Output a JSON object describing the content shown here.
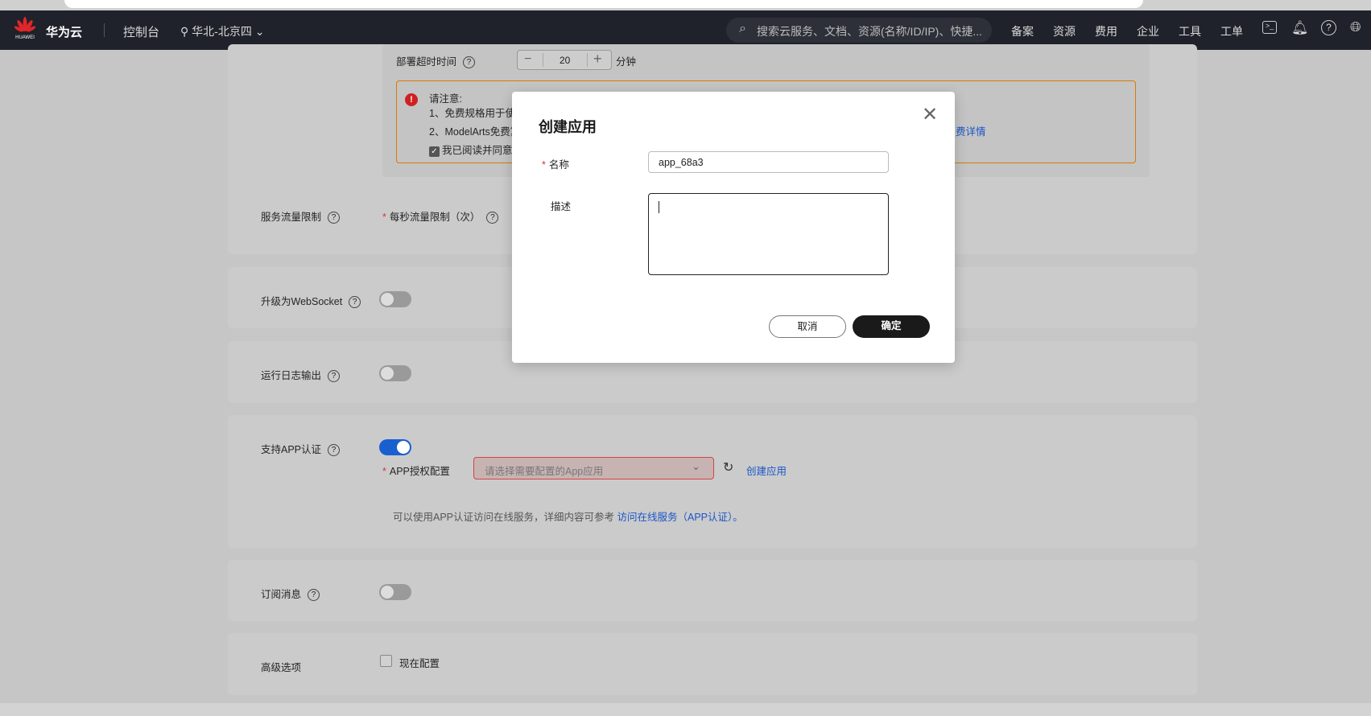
{
  "nav": {
    "brand": "华为云",
    "logo_text": "HUAWEI",
    "console": "控制台",
    "region": "华北-北京四",
    "search_placeholder": "搜索云服务、文档、资源(名称/ID/IP)、快捷...",
    "links": [
      "备案",
      "资源",
      "费用",
      "企业",
      "工具",
      "工单"
    ]
  },
  "deploy": {
    "timeout_label": "部署超时时间",
    "timeout_value": "20",
    "timeout_unit": "分钟"
  },
  "notice": {
    "title": "请注意:",
    "line1": "1、免费规格用于使",
    "line2": "2、ModelArts免费算",
    "agree": "我已阅读并同意",
    "link_tail": "费详情"
  },
  "flow": {
    "label": "服务流量限制",
    "sub_label": "每秒流量限制（次）"
  },
  "websocket": {
    "label": "升级为WebSocket",
    "enabled": false
  },
  "log": {
    "label": "运行日志输出",
    "enabled": false
  },
  "app_auth": {
    "label": "支持APP认证",
    "enabled": true,
    "config_label": "APP授权配置",
    "select_placeholder": "请选择需要配置的App应用",
    "create_link": "创建应用",
    "hint": "可以使用APP认证访问在线服务，详细内容可参考",
    "hint_link": "访问在线服务（APP认证）",
    "hint_end": "。"
  },
  "subscribe": {
    "label": "订阅消息",
    "enabled": false
  },
  "advanced": {
    "label": "高级选项",
    "checkbox_label": "现在配置",
    "checked": false
  },
  "dialog": {
    "title": "创建应用",
    "name_label": "名称",
    "name_value": "app_68a3",
    "desc_label": "描述",
    "desc_value": "",
    "cancel": "取消",
    "confirm": "确定"
  }
}
